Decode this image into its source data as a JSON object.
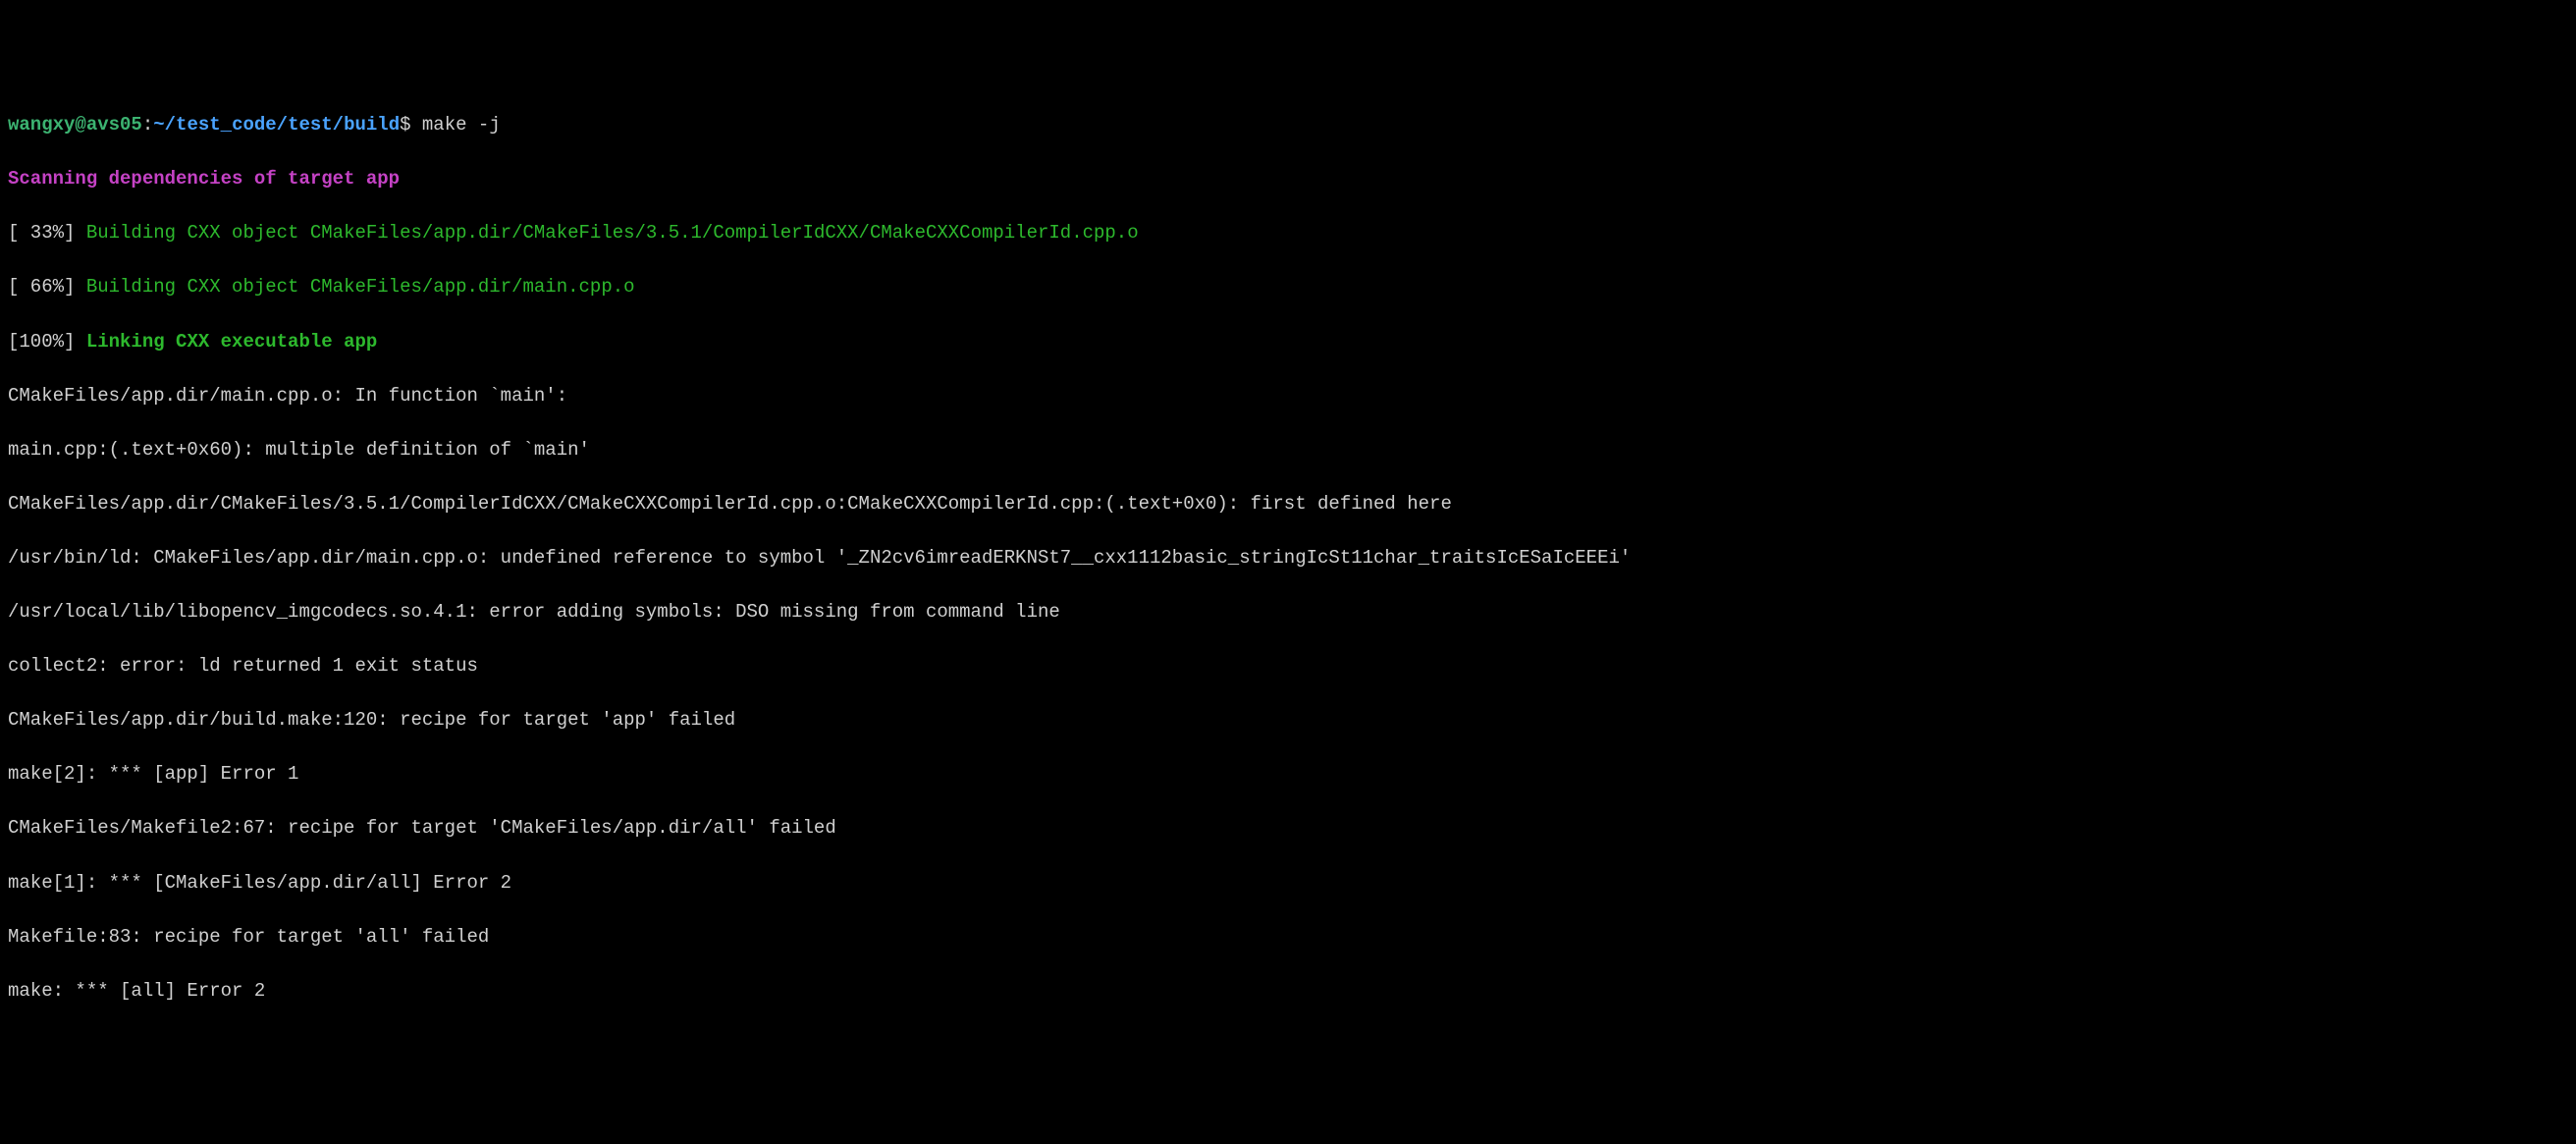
{
  "prompt": {
    "user": "wangxy",
    "at": "@",
    "host": "avs05",
    "colon": ":",
    "path": "~/test_code/test/build",
    "dollar": "$",
    "command": " make -j"
  },
  "lines": {
    "scan": "Scanning dependencies of target app",
    "p33_pct": "[ 33%] ",
    "p33_msg": "Building CXX object CMakeFiles/app.dir/CMakeFiles/3.5.1/CompilerIdCXX/CMakeCXXCompilerId.cpp.o",
    "p66_pct": "[ 66%] ",
    "p66_msg": "Building CXX object CMakeFiles/app.dir/main.cpp.o",
    "p100_pct": "[100%] ",
    "p100_msg": "Linking CXX executable app",
    "err1": "CMakeFiles/app.dir/main.cpp.o: In function `main':",
    "err2": "main.cpp:(.text+0x60): multiple definition of `main'",
    "err3": "CMakeFiles/app.dir/CMakeFiles/3.5.1/CompilerIdCXX/CMakeCXXCompilerId.cpp.o:CMakeCXXCompilerId.cpp:(.text+0x0): first defined here",
    "err4": "/usr/bin/ld: CMakeFiles/app.dir/main.cpp.o: undefined reference to symbol '_ZN2cv6imreadERKNSt7__cxx1112basic_stringIcSt11char_traitsIcESaIcEEEi'",
    "err5": "/usr/local/lib/libopencv_imgcodecs.so.4.1: error adding symbols: DSO missing from command line",
    "err6": "collect2: error: ld returned 1 exit status",
    "err7": "CMakeFiles/app.dir/build.make:120: recipe for target 'app' failed",
    "err8": "make[2]: *** [app] Error 1",
    "err9": "CMakeFiles/Makefile2:67: recipe for target 'CMakeFiles/app.dir/all' failed",
    "err10": "make[1]: *** [CMakeFiles/app.dir/all] Error 2",
    "err11": "Makefile:83: recipe for target 'all' failed",
    "err12": "make: *** [all] Error 2"
  }
}
